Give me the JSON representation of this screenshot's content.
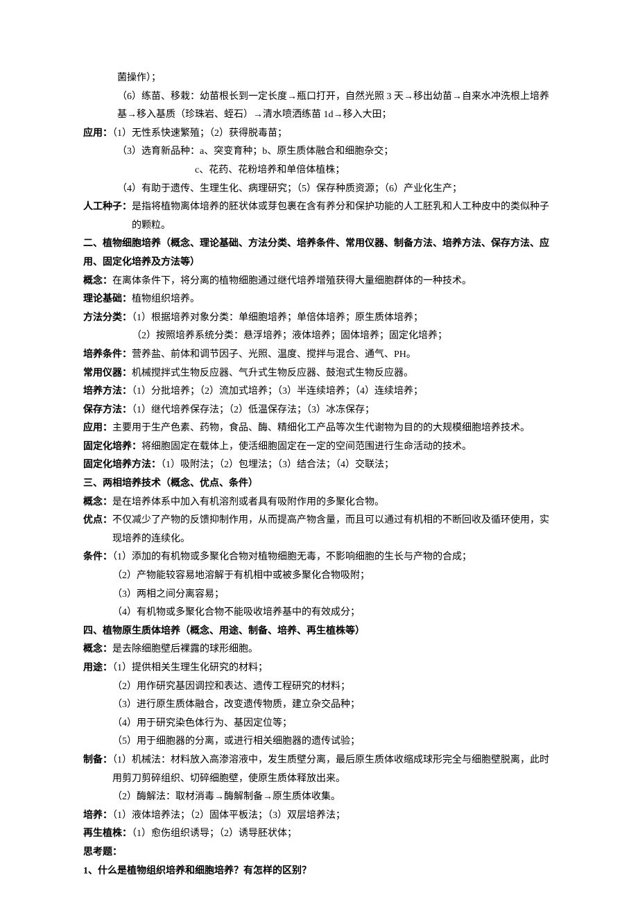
{
  "p": [
    "菌操作）；",
    "（6）练苗、移栽：幼苗根长到一定长度→瓶口打开，自然光照 3 天→移出幼苗→自来水冲洗根上培养基→移入基质（珍珠岩、蛭石）→清水喷洒练苗 1d→移入大田；",
    "应用：（1）无性系快速繁殖；（2）获得脱毒苗；",
    "（3）选育新品种：a、突变育种；b、原生质体融合和细胞杂交；",
    "c、花药、花粉培养和单倍体植株；",
    "（4）有助于遗传、生理生化、病理研究；（5）保存种质资源；（6）产业化生产；",
    "人工种子：是指将植物离体培养的胚状体或芽包裹在含有养分和保护功能的人工胚乳和人工种皮中的类似种子的颗粒。",
    "二、植物细胞培养（概念、理论基础、方法分类、培养条件、常用仪器、制备方法、培养方法、保存方法、应用、固定化培养及方法等）",
    "概念：在离体条件下，将分离的植物细胞通过继代培养增殖获得大量细胞群体的一种技术。",
    "理论基础：植物组织培养。",
    "方法分类：（1）根据培养对象分类：单细胞培养；单倍体培养；原生质体培养；",
    "（2）按照培养系统分类：悬浮培养；液体培养；固体培养；固定化培养；",
    "培养条件：营养盐、前体和调节因子、光照、温度、搅拌与混合、通气、PH。",
    "常用仪器：机械搅拌式生物反应器、气升式生物反应器、鼓泡式生物反应器。",
    "培养方法：（1）分批培养；（2）流加式培养；（3）半连续培养；（4）连续培养；",
    "保存方法：（1）继代培养保存法；（2）低温保存法；（3）冰冻保存；",
    "应用：主要用于生产色素、药物，食品、酶、精细化工产品等次生代谢物为目的的大规模细胞培养技术。",
    "固定化培养：将细胞固定在载体上，使活细胞固定在一定的空间范围进行生命活动的技术。",
    "固定化培养方法：（1）吸附法；（2）包埋法；（3）结合法；（4）交联法；",
    "三、两相培养技术（概念、优点、条件）",
    "概念：是在培养体系中加入有机溶剂或者具有吸附作用的多聚化合物。",
    "优点：不仅减少了产物的反馈抑制作用，从而提高产物含量，而且可以通过有机相的不断回收及循环使用，实现培养的连续化。",
    "条件：（1）添加的有机物或多聚化合物对植物细胞无毒，不影响细胞的生长与产物的合成；",
    "（2）产物能较容易地溶解于有机相中或被多聚化合物吸附；",
    "（3）两相之间分离容易；",
    "（4）有机物或多聚化合物不能吸收培养基中的有效成分；",
    "四、植物原生质体培养（概念、用途、制备、培养、再生植株等）",
    "概念：是去除细胞壁后裸露的球形细胞。",
    "用途：（1）提供相关生理生化研究的材料；",
    "（2）用作研究基因调控和表达、遗传工程研究的材料；",
    "（3）进行原生质体融合，改变遗传物质，建立杂交品种；",
    "（4）用于研究染色体行为、基因定位等；",
    "（5）用于细胞器的分离，或进行相关细胞器的遗传试验；",
    "制备：（1）机械法：材料放入高渗溶液中，发生质壁分离，最后原生质体收缩成球形完全与细胞壁脱离，此时用剪刀剪碎组织、切碎细胞壁，使原生质体释放出来。",
    "（2）酶解法：取材消毒→酶解制备→原生质体收集。",
    "培养：（1）液体培养法；（2）固体平板法；（3）双层培养法；",
    "再生植株：（1）愈伤组织诱导；（2）诱导胚状体；",
    "思考题：",
    "1、什么是植物组织培养和细胞培养？有怎样的区别？"
  ]
}
